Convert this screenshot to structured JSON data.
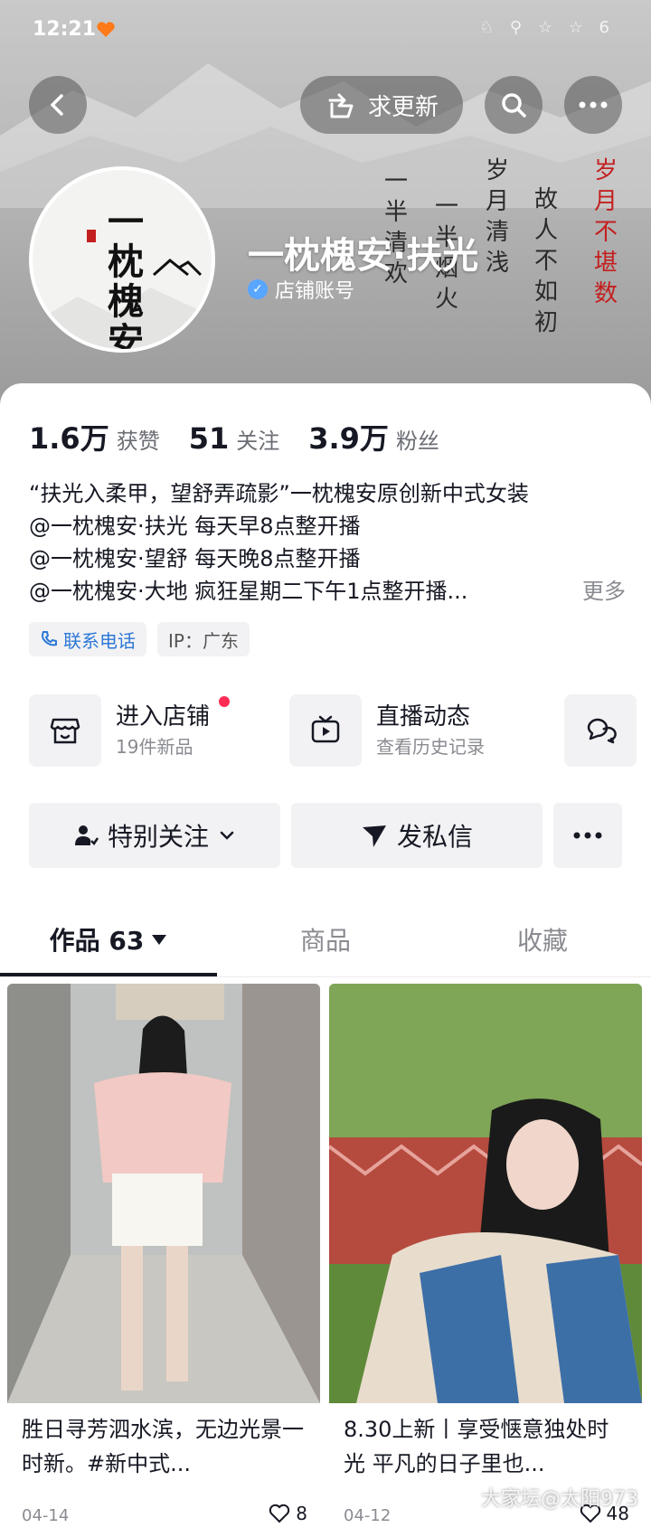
{
  "status_bar": {
    "time": "12:21",
    "icons": "♘ ⚲ ☆ ☆ 6"
  },
  "header": {
    "update_request_label": "求更新",
    "nickname": "一枕槐安·扶光",
    "account_type": "店铺账号"
  },
  "avatar": {
    "text": "一枕槐安"
  },
  "poem": {
    "col1": "岁月不堪数",
    "col2": "故人不如初",
    "col3": "岁月清浅",
    "col4": "一半烟火",
    "col5": "一半清欢"
  },
  "stats": [
    {
      "value": "1.6万",
      "label": "获赞"
    },
    {
      "value": "51",
      "label": "关注"
    },
    {
      "value": "3.9万",
      "label": "粉丝"
    }
  ],
  "bio": {
    "lines": [
      "“扶光入柔甲，望舒弄疏影”一枕槐安原创新中式女装",
      "@一枕槐安·扶光   每天早8点整开播",
      "@一枕槐安·望舒   每天晚8点整开播",
      "@一枕槐安·大地   疯狂星期二下午1点整开播..."
    ],
    "more": "更多"
  },
  "chips": {
    "phone": "联系电话",
    "ip": "IP：广东"
  },
  "shortcuts": [
    {
      "title": "进入店铺",
      "subtitle": "19件新品"
    },
    {
      "title": "直播动态",
      "subtitle": "查看历史记录"
    }
  ],
  "actions": {
    "follow": "特别关注",
    "message": "发私信"
  },
  "tabs": [
    {
      "label": "作品 63"
    },
    {
      "label": "商品"
    },
    {
      "label": "收藏"
    }
  ],
  "posts": [
    {
      "title": "胜日寻芳泗水滨，无边光景一时新。#新中式...",
      "date": "04-14",
      "likes": "8"
    },
    {
      "title": "8.30上新丨享受惬意独处时光 平凡的日子里也...",
      "date": "04-12",
      "likes": "48"
    }
  ],
  "watermark": "大家坛@太阳973",
  "colors": {
    "accent_red": "#fe2c55",
    "link_blue": "#2d78d6",
    "verified_blue": "#58a6ff"
  }
}
